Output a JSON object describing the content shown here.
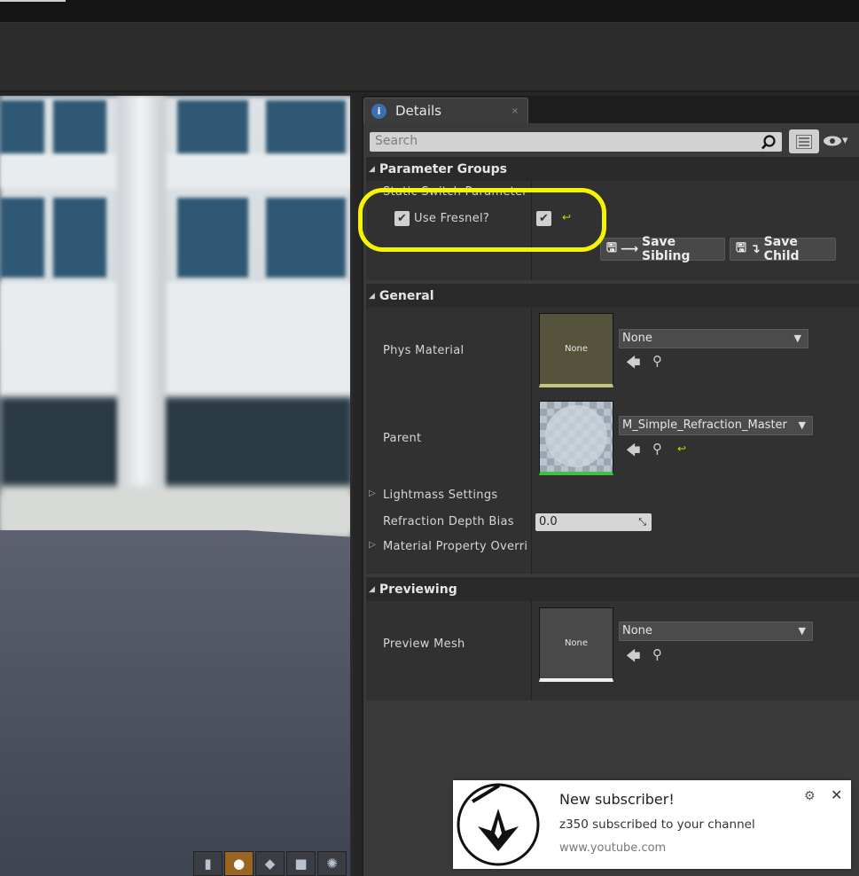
{
  "details": {
    "tab_title": "Details",
    "tab_close": "×",
    "search_placeholder": "Search",
    "eye_dropdown": "▾"
  },
  "parameter_groups": {
    "title": "Parameter Groups",
    "subheader": "Static Switch Parameter",
    "use_fresnel_label": "Use Fresnel?",
    "use_fresnel_checked": true,
    "save_sibling_label": "Save Sibling",
    "save_child_label": "Save Child"
  },
  "general": {
    "title": "General",
    "phys_material_label": "Phys Material",
    "phys_material_thumb": "None",
    "phys_material_value": "None",
    "parent_label": "Parent",
    "parent_value": "M_Simple_Refraction_Master",
    "lightmass_label": "Lightmass Settings",
    "refraction_label": "Refraction Depth Bias",
    "refraction_value": "0.0",
    "material_property_label": "Material Property Overric"
  },
  "previewing": {
    "title": "Previewing",
    "preview_mesh_label": "Preview Mesh",
    "preview_mesh_thumb": "None",
    "preview_mesh_value": "None"
  },
  "notification": {
    "title": "New subscriber!",
    "message": "z350 subscribed to your channel",
    "site": "www.youtube.com"
  },
  "colors": {
    "highlight": "#f5f500",
    "accent": "#9a6520",
    "panel": "#3a3a3a"
  },
  "icons": [
    "search-icon",
    "list-view-icon",
    "eye-icon",
    "back-arrow-icon",
    "browse-icon",
    "reset-icon",
    "save-icon",
    "gear-icon",
    "close-icon",
    "info-icon"
  ]
}
